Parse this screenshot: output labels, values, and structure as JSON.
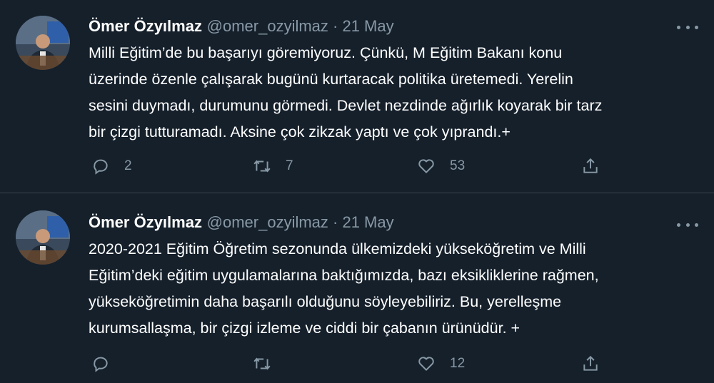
{
  "tweets": [
    {
      "name": "Ömer Özyılmaz",
      "meta": "@omer_ozyilmaz · 21 May",
      "text": "Milli Eğitim’de bu başarıyı göremiyoruz. Çünkü, M Eğitim Bakanı konu\nüzerinde özenle çalışarak bugünü kurtaracak politika üretemedi. Yerelin\nsesini duymadı, durumunu görmedi. Devlet nezdinde ağırlık koyarak bir tarz\nbir çizgi tutturamadı. Aksine çok zikzak yaptı ve çok yıprandı.+",
      "replies": "2",
      "retweets": "7",
      "likes": "53"
    },
    {
      "name": "Ömer Özyılmaz",
      "meta": "@omer_ozyilmaz · 21 May",
      "text": "2020-2021 Eğitim Öğretim sezonunda ülkemizdeki yükseköğretim ve Milli\nEğitim’deki eğitim uygulamalarına baktığımızda, bazı eksikliklerine rağmen,\nyükseköğretimin daha başarılı olduğunu söyleyebiliriz. Bu, yerelleşme\nkurumsallaşma, bir çizgi izleme ve ciddi bir çabanın ürünüdür. +",
      "replies": "",
      "retweets": "",
      "likes": "12"
    }
  ],
  "colors": {
    "background": "#15202b",
    "secondary_text": "#8899a6",
    "divider": "#38444d"
  },
  "icons": [
    "reply-icon",
    "retweet-icon",
    "like-icon",
    "share-icon",
    "more-icon"
  ]
}
